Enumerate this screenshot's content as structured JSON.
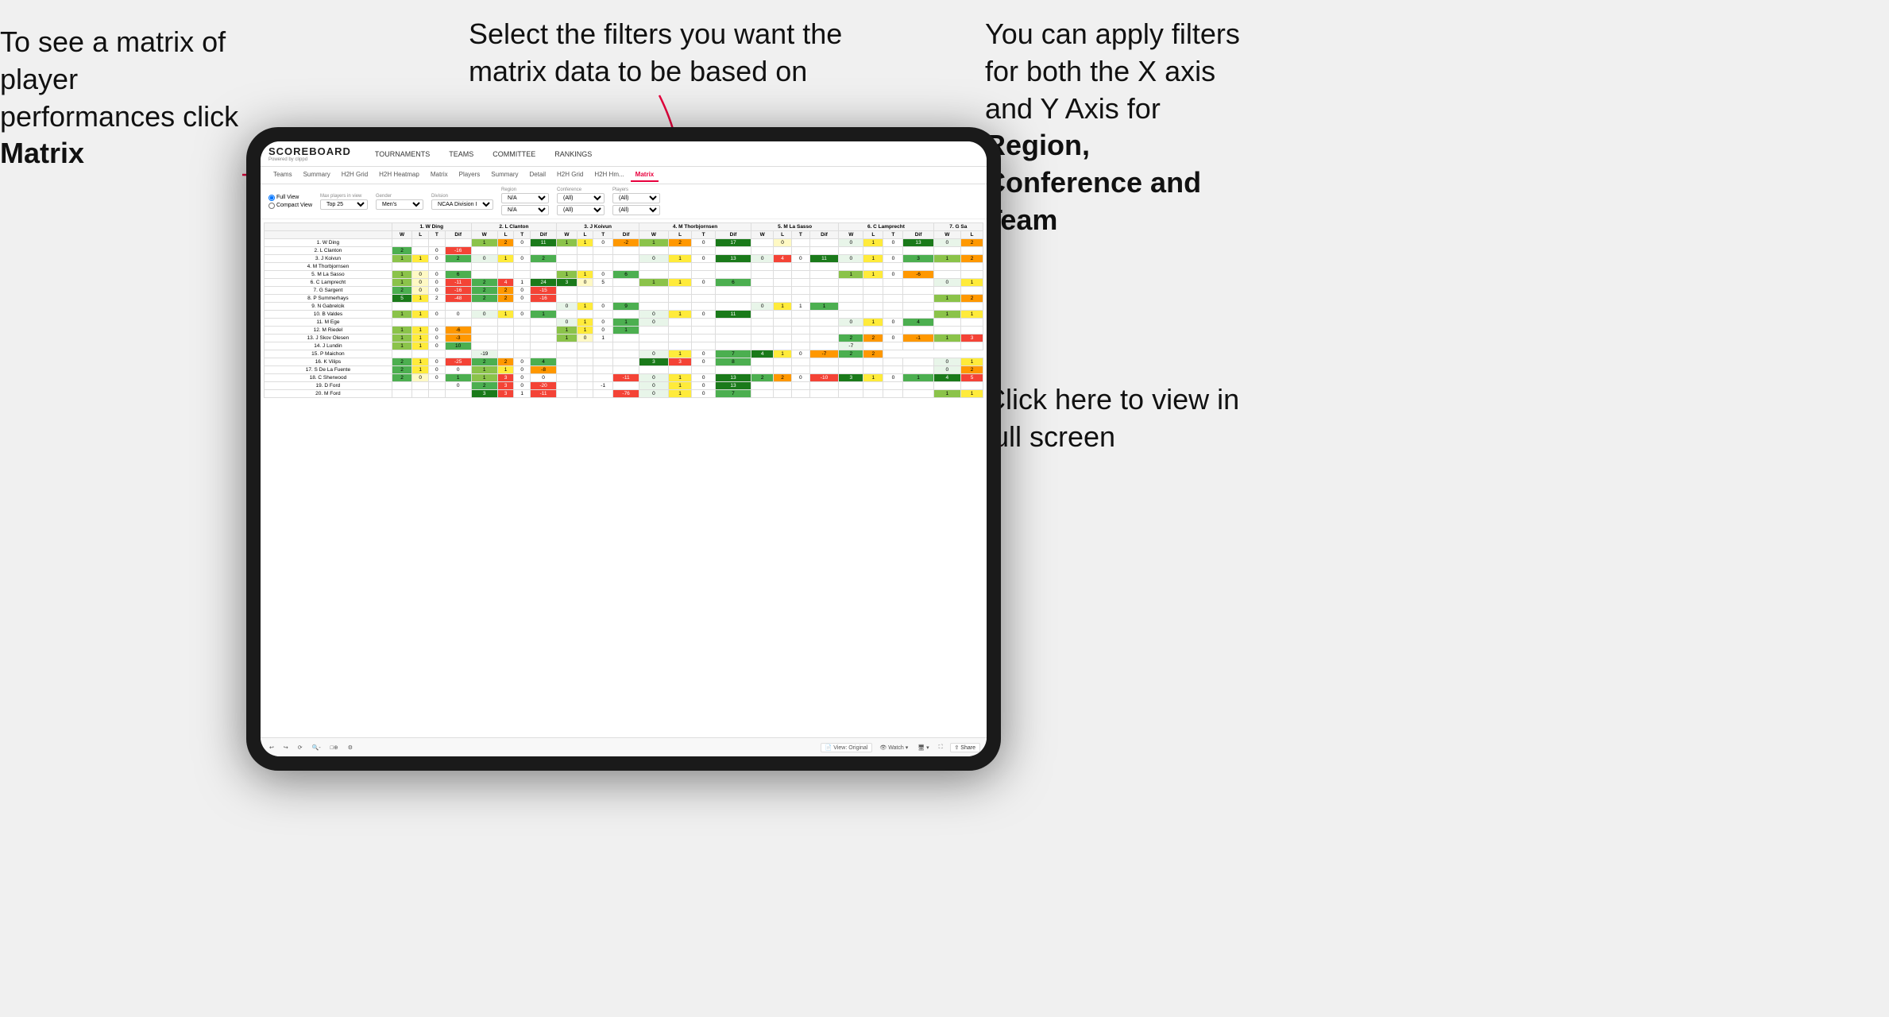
{
  "annotations": {
    "matrix_text": "To see a matrix of player performances click ",
    "matrix_bold": "Matrix",
    "filters_text": "Select the filters you want the matrix data to be based on",
    "axis_text": "You  can apply filters for both the X axis and Y Axis for ",
    "axis_bold": "Region, Conference and Team",
    "fullscreen_text": "Click here to view in full screen"
  },
  "app": {
    "logo": "SCOREBOARD",
    "logo_sub": "Powered by clippd",
    "nav_items": [
      "TOURNAMENTS",
      "TEAMS",
      "COMMITTEE",
      "RANKINGS"
    ],
    "sec_tabs": [
      "Teams",
      "Summary",
      "H2H Grid",
      "H2H Heatmap",
      "Matrix",
      "Players",
      "Summary",
      "Detail",
      "H2H Grid",
      "H2H Hm...",
      "Matrix"
    ],
    "active_tab": "Matrix",
    "filters": {
      "view_options": [
        "Full View",
        "Compact View"
      ],
      "active_view": "Full View",
      "max_players_label": "Max players in view",
      "max_players_value": "Top 25",
      "gender_label": "Gender",
      "gender_value": "Men's",
      "division_label": "Division",
      "division_value": "NCAA Division I",
      "region_label": "Region",
      "region_value": "N/A",
      "conference_label": "Conference",
      "conference_value": "(All)",
      "players_label": "Players",
      "players_value": "(All)"
    },
    "column_headers": [
      "1. W Ding",
      "2. L Clanton",
      "3. J Koivun",
      "4. M Thorbjornsen",
      "5. M La Sasso",
      "6. C Lamprecht",
      "7. G Sa"
    ],
    "sub_headers": [
      "W",
      "L",
      "T",
      "Dif"
    ],
    "rows": [
      {
        "name": "1. W Ding",
        "cells": [
          "",
          "",
          "",
          "",
          "1",
          "2",
          "0",
          "11",
          "1",
          "1",
          "0",
          "-2",
          "1",
          "2",
          "0",
          "17",
          "",
          "0",
          "",
          "",
          "0",
          "1",
          "0",
          "13",
          "0",
          "2"
        ]
      },
      {
        "name": "2. L Clanton",
        "cells": [
          "2",
          "",
          "0",
          "-16",
          "",
          "",
          "",
          "",
          "",
          "",
          "",
          "",
          "",
          "",
          "",
          "",
          "",
          "",
          "",
          "",
          "",
          "",
          "",
          "",
          "",
          ""
        ]
      },
      {
        "name": "3. J Koivun",
        "cells": [
          "1",
          "1",
          "0",
          "2",
          "0",
          "1",
          "0",
          "2",
          "",
          "",
          "",
          "",
          "0",
          "1",
          "0",
          "13",
          "0",
          "4",
          "0",
          "11",
          "0",
          "1",
          "0",
          "3",
          "1",
          "2"
        ]
      },
      {
        "name": "4. M Thorbjornsen",
        "cells": [
          "",
          "",
          "",
          "",
          "",
          "",
          "",
          "",
          "",
          "",
          "",
          "",
          "",
          "",
          "",
          "",
          "",
          "",
          "",
          "",
          "",
          "",
          "",
          "",
          "",
          ""
        ]
      },
      {
        "name": "5. M La Sasso",
        "cells": [
          "1",
          "0",
          "0",
          "6",
          "",
          "",
          "",
          "",
          "1",
          "1",
          "0",
          "6",
          "",
          "",
          "",
          "",
          "",
          "",
          "",
          "",
          "1",
          "1",
          "0",
          "-6",
          "",
          ""
        ]
      },
      {
        "name": "6. C Lamprecht",
        "cells": [
          "1",
          "0",
          "0",
          "-11",
          "2",
          "4",
          "1",
          "24",
          "3",
          "0",
          "5",
          "",
          "1",
          "1",
          "0",
          "6",
          "",
          "",
          "",
          "",
          "",
          "",
          "",
          "",
          "0",
          "1"
        ]
      },
      {
        "name": "7. G Sargent",
        "cells": [
          "2",
          "0",
          "0",
          "-16",
          "2",
          "2",
          "0",
          "-15",
          "",
          "",
          "",
          "",
          "",
          "",
          "",
          "",
          "",
          "",
          "",
          "",
          "",
          "",
          "",
          "",
          "",
          ""
        ]
      },
      {
        "name": "8. P Summerhays",
        "cells": [
          "5",
          "1",
          "2",
          "-48",
          "2",
          "2",
          "0",
          "-16",
          "",
          "",
          "",
          "",
          "",
          "",
          "",
          "",
          "",
          "",
          "",
          "",
          "",
          "",
          "",
          "",
          "1",
          "2"
        ]
      },
      {
        "name": "9. N Gabrelcik",
        "cells": [
          "",
          "",
          "",
          "",
          "",
          "",
          "",
          "",
          "0",
          "1",
          "0",
          "9",
          "",
          "",
          "",
          "",
          "0",
          "1",
          "1",
          "1",
          "",
          "",
          "",
          "",
          "",
          ""
        ]
      },
      {
        "name": "10. B Valdes",
        "cells": [
          "1",
          "1",
          "0",
          "0",
          "0",
          "1",
          "0",
          "1",
          "",
          "",
          "",
          "",
          "0",
          "1",
          "0",
          "11",
          "",
          "",
          "",
          "",
          "",
          "",
          "",
          "",
          "1",
          "1"
        ]
      },
      {
        "name": "11. M Ege",
        "cells": [
          "",
          "",
          "",
          "",
          "",
          "",
          "",
          "",
          "0",
          "1",
          "0",
          "1",
          "0",
          "",
          "",
          "",
          "",
          "",
          "",
          "",
          "0",
          "1",
          "0",
          "4",
          "",
          ""
        ]
      },
      {
        "name": "12. M Riedel",
        "cells": [
          "1",
          "1",
          "0",
          "-6",
          "",
          "",
          "",
          "",
          "1",
          "1",
          "0",
          "1",
          "",
          "",
          "",
          "",
          "",
          "",
          "",
          "",
          "",
          "",
          "",
          "",
          "",
          ""
        ]
      },
      {
        "name": "13. J Skov Olesen",
        "cells": [
          "1",
          "1",
          "0",
          "-3",
          "",
          "",
          "",
          "",
          "1",
          "0",
          "1",
          "",
          "",
          "",
          "",
          "",
          "",
          "",
          "",
          "",
          "2",
          "2",
          "0",
          "-1",
          "1",
          "3"
        ]
      },
      {
        "name": "14. J Lundin",
        "cells": [
          "1",
          "1",
          "0",
          "10",
          "",
          "",
          "",
          "",
          "",
          "",
          "",
          "",
          "",
          "",
          "",
          "",
          "",
          "",
          "",
          "",
          "-7",
          "",
          "",
          "",
          "",
          ""
        ]
      },
      {
        "name": "15. P Maichon",
        "cells": [
          "",
          "",
          "",
          "",
          "-19",
          "",
          "",
          "",
          "",
          "",
          "",
          "",
          "0",
          "1",
          "0",
          "7",
          "4",
          "1",
          "0",
          "-7",
          "2",
          "2"
        ]
      },
      {
        "name": "16. K Vilips",
        "cells": [
          "2",
          "1",
          "0",
          "-25",
          "2",
          "2",
          "0",
          "4",
          "",
          "",
          "",
          "",
          "3",
          "3",
          "0",
          "8",
          "",
          "",
          "",
          "",
          "",
          "",
          "",
          "",
          "0",
          "1"
        ]
      },
      {
        "name": "17. S De La Fuente",
        "cells": [
          "2",
          "1",
          "0",
          "0",
          "1",
          "1",
          "0",
          "-8",
          "",
          "",
          "",
          "",
          "",
          "",
          "",
          "",
          "",
          "",
          "",
          "",
          "",
          "",
          "",
          "",
          "0",
          "2"
        ]
      },
      {
        "name": "18. C Sherwood",
        "cells": [
          "2",
          "0",
          "0",
          "1",
          "1",
          "3",
          "0",
          "0",
          "",
          "",
          "",
          "-11",
          "0",
          "1",
          "0",
          "13",
          "2",
          "2",
          "0",
          "-10",
          "3",
          "1",
          "0",
          "1",
          "4",
          "5"
        ]
      },
      {
        "name": "19. D Ford",
        "cells": [
          "",
          "",
          "",
          "0",
          "2",
          "3",
          "0",
          "-20",
          "",
          "",
          "-1",
          "",
          "0",
          "1",
          "0",
          "13",
          "",
          "",
          "",
          "",
          "",
          "",
          "",
          "",
          "",
          ""
        ]
      },
      {
        "name": "20. M Ford",
        "cells": [
          "",
          "",
          "",
          "",
          "3",
          "3",
          "1",
          "-11",
          "",
          "",
          "",
          "-76",
          "0",
          "1",
          "0",
          "7",
          "",
          "",
          "",
          "",
          "",
          "",
          "",
          "",
          "1",
          "1"
        ]
      }
    ],
    "bottom_toolbar": {
      "view_label": "View: Original",
      "watch_label": "Watch",
      "share_label": "Share"
    }
  }
}
